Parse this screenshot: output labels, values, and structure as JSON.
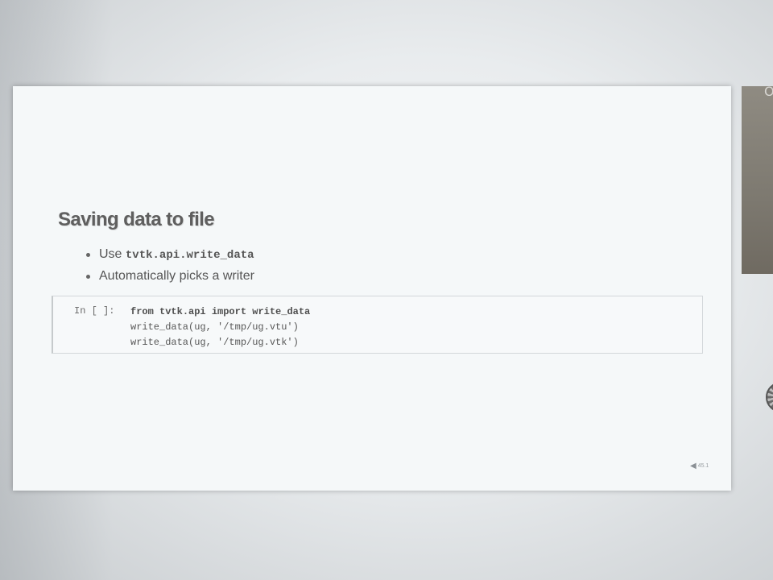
{
  "slide": {
    "title": "Saving data to file",
    "bullets": [
      {
        "prefix": "Use ",
        "code": "tvtk.api.write_data"
      },
      {
        "prefix": "Automatically picks a writer",
        "code": ""
      }
    ],
    "cell": {
      "prompt": "In [ ]:",
      "line1_kw1": "from",
      "line1_mid": " tvtk.api ",
      "line1_kw2": "import",
      "line1_end": " write_data",
      "line2": "write_data(ug, '/tmp/ug.vtu')",
      "line3": "write_data(ug, '/tmp/ug.vtk')"
    },
    "nav": {
      "arrow_icon": "◀",
      "slide_number": "45.1"
    }
  },
  "side": {
    "glyph": "O"
  },
  "colors": {
    "slide_bg": "#f5f8f9",
    "title": "#5f5f5f",
    "text": "#555555"
  }
}
